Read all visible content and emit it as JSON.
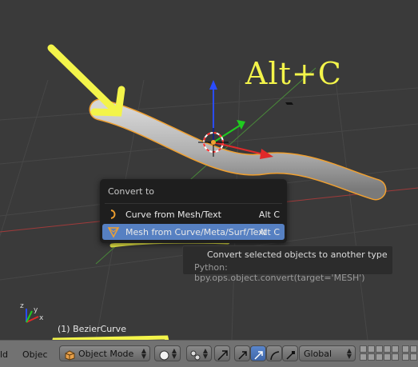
{
  "viewport": {
    "annotation": "Alt+C",
    "object_name": "(1) BezierCurve"
  },
  "menu": {
    "title": "Convert to",
    "items": [
      {
        "label": "Curve from Mesh/Text",
        "shortcut": "Alt C",
        "icon": "curve-icon"
      },
      {
        "label": "Mesh from Curve/Meta/Surf/Text",
        "shortcut": "Alt C",
        "icon": "mesh-icon",
        "highlighted": true
      }
    ]
  },
  "tooltip": {
    "description": "Convert selected objects to another type",
    "python": "Python: bpy.ops.object.convert(target='MESH')"
  },
  "header": {
    "view_partial": "ld",
    "object_partial": "Objec",
    "mode": "Object Mode",
    "orientation": "Global"
  },
  "colors": {
    "annotation": "#f3f44a",
    "highlight": "#5680c2",
    "selection_outline": "#f0a030"
  }
}
